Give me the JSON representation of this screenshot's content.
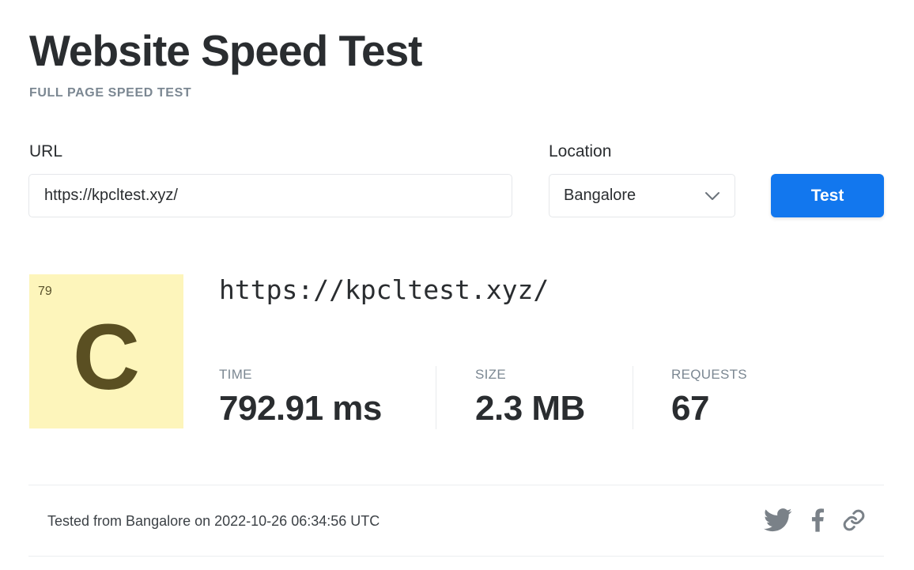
{
  "header": {
    "title": "Website Speed Test",
    "subtitle": "FULL PAGE SPEED TEST"
  },
  "form": {
    "url_label": "URL",
    "url_value": "https://kpcltest.xyz/",
    "location_label": "Location",
    "location_value": "Bangalore",
    "test_button_label": "Test",
    "accent_color": "#1277ee"
  },
  "result": {
    "grade_score": "79",
    "grade_letter": "C",
    "grade_color": "#fdf5bb",
    "tested_url": "https://kpcltest.xyz/",
    "metrics": [
      {
        "label": "TIME",
        "value": "792.91 ms"
      },
      {
        "label": "SIZE",
        "value": "2.3 MB"
      },
      {
        "label": "REQUESTS",
        "value": "67"
      }
    ]
  },
  "footer": {
    "tested_text": "Tested from Bangalore on 2022-10-26 06:34:56 UTC",
    "share_icons": [
      "twitter-icon",
      "facebook-icon",
      "link-icon"
    ]
  }
}
